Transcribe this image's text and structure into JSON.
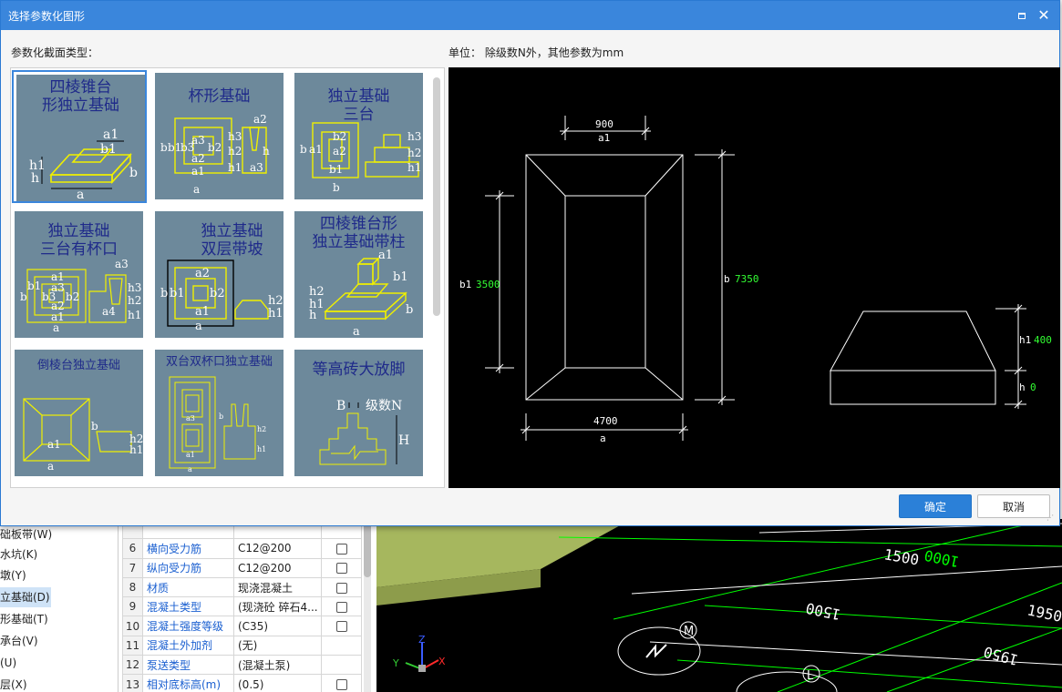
{
  "dialog": {
    "title": "选择参数化图形",
    "section_label": "参数化截面类型：",
    "unit_label": "单位：  除级数N外，其他参数为mm",
    "ok_label": "确定",
    "cancel_label": "取消",
    "max_icon": "maximize-icon",
    "close_icon": "close-icon"
  },
  "thumbnails": [
    {
      "title": "四棱锥台\n形独立基础",
      "selected": true
    },
    {
      "title": "杯形基础",
      "selected": false
    },
    {
      "title": "独立基础\n三台",
      "selected": false
    },
    {
      "title": "独立基础\n三台有杯口",
      "selected": false
    },
    {
      "title": "独立基础\n双层带坡",
      "selected": false
    },
    {
      "title": "四棱锥台形\n独立基础带柱",
      "selected": false
    },
    {
      "title": "倒棱台独立基础",
      "selected": false
    },
    {
      "title": "双台双杯口独立基础",
      "selected": false
    },
    {
      "title": "等高砖大放脚",
      "selected": false
    }
  ],
  "thumb_labels": {
    "a": "a",
    "a1": "a1",
    "a2": "a2",
    "a3": "a3",
    "a4": "a4",
    "b": "b",
    "b1": "b1",
    "b2": "b2",
    "b3": "b3",
    "h": "h",
    "h1": "h1",
    "h2": "h2",
    "h3": "h3",
    "B": "B",
    "H": "H",
    "N": "级数N"
  },
  "preview": {
    "a1_value": "900",
    "a1_name": "a1",
    "a_value": "4700",
    "a_name": "a",
    "b1_name": "b1",
    "b1_value": "3500",
    "b_name": "b",
    "b_value": "7350",
    "h1_name": "h1",
    "h1_value": "400",
    "h_name": "h",
    "h_value": "0"
  },
  "colors": {
    "title_bar": "#3a86dc",
    "thumb_bg": "#6d899b",
    "thumb_title": "#1f2a8a",
    "thumb_line": "#f0f000",
    "preview_bg": "#000000",
    "value_green": "#33ff33",
    "cad_green": "#00ff00",
    "property_blue": "#1a5fd0"
  },
  "bg_tree": [
    {
      "label": "础板带(W)",
      "selected": false
    },
    {
      "label": "水坑(K)",
      "selected": false
    },
    {
      "label": "墩(Y)",
      "selected": false
    },
    {
      "label": "立基础(D)",
      "selected": true
    },
    {
      "label": "形基础(T)",
      "selected": false
    },
    {
      "label": "承台(V)",
      "selected": false
    },
    {
      "label": "(U)",
      "selected": false
    },
    {
      "label": "层(X)",
      "selected": false
    }
  ],
  "bg_props": [
    {
      "num": "6",
      "name": "横向受力筋",
      "value": "C12@200",
      "check": true
    },
    {
      "num": "7",
      "name": "纵向受力筋",
      "value": "C12@200",
      "check": true
    },
    {
      "num": "8",
      "name": "材质",
      "value": "现浇混凝土",
      "check": true
    },
    {
      "num": "9",
      "name": "混凝土类型",
      "value": "(现浇砼 碎石4...",
      "check": true
    },
    {
      "num": "10",
      "name": "混凝土强度等级",
      "value": "(C35)",
      "check": true
    },
    {
      "num": "11",
      "name": "混凝土外加剂",
      "value": "(无)",
      "check": false
    },
    {
      "num": "12",
      "name": "泵送类型",
      "value": "(混凝土泵)",
      "check": false
    },
    {
      "num": "13",
      "name": "相对底标高(m)",
      "value": "(0.5)",
      "check": true
    }
  ],
  "bg_cad": {
    "dim1": "1500",
    "dim2": "1000",
    "dim3": "1500",
    "dim4": "1950",
    "dim5": "1950",
    "axis_m": "M",
    "axis_l": "L",
    "axis_x": "X",
    "axis_y": "Y",
    "axis_z": "Z"
  }
}
